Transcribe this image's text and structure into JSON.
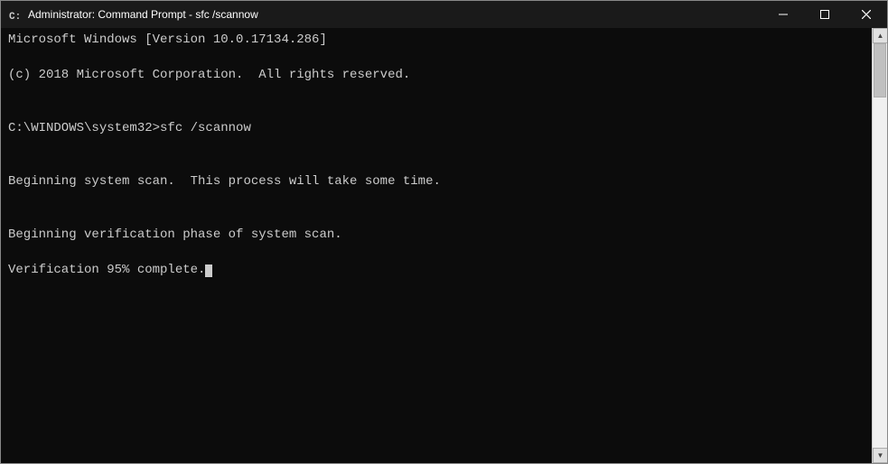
{
  "window": {
    "title": "Administrator: Command Prompt - sfc /scannow",
    "titlebar_bg": "#1a1a1a"
  },
  "controls": {
    "minimize": "—",
    "maximize": "□",
    "close": "✕"
  },
  "terminal": {
    "lines": [
      "Microsoft Windows [Version 10.0.17134.286]",
      "(c) 2018 Microsoft Corporation.  All rights reserved.",
      "",
      "C:\\WINDOWS\\system32>sfc /scannow",
      "",
      "Beginning system scan.  This process will take some time.",
      "",
      "Beginning verification phase of system scan.",
      "Verification 95% complete."
    ]
  }
}
